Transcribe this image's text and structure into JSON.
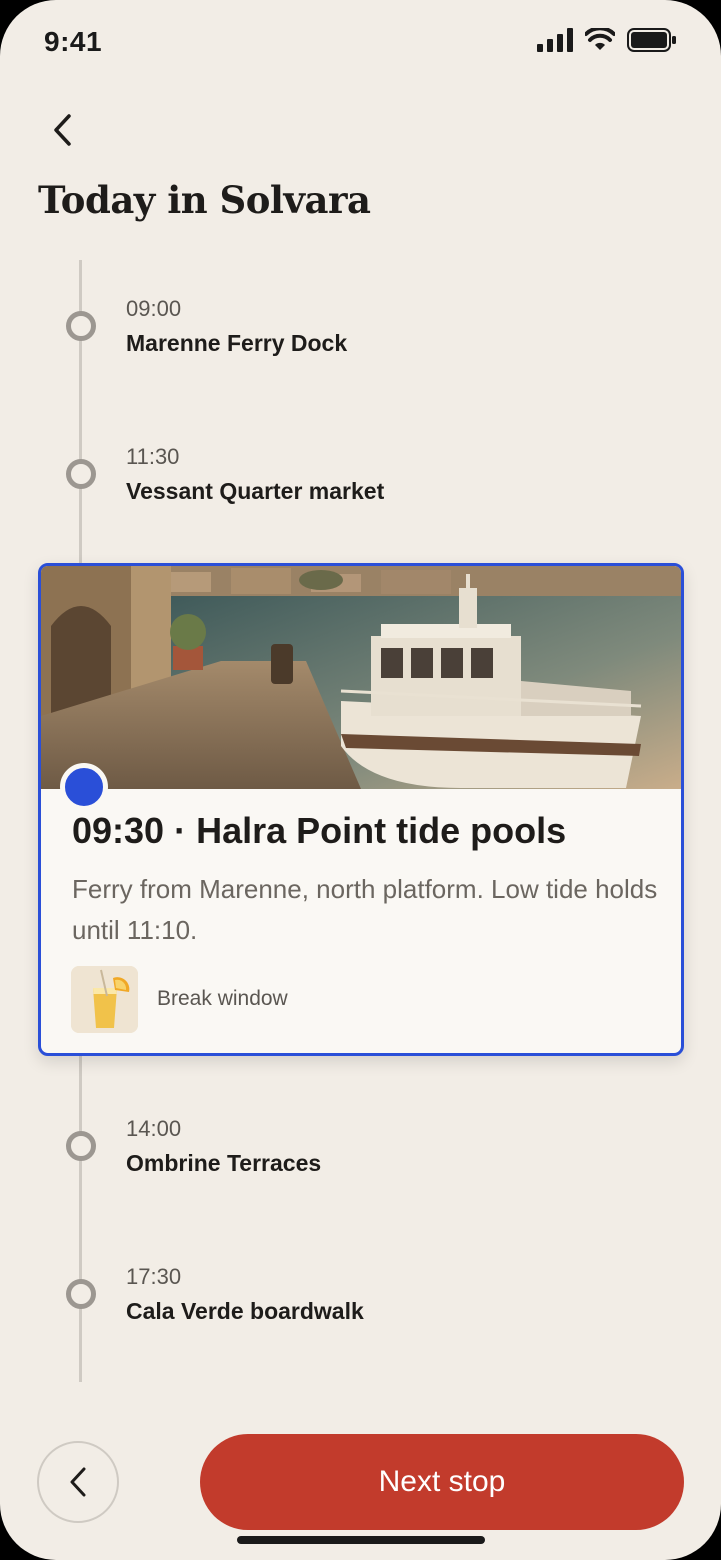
{
  "status_bar": {
    "time": "9:41",
    "icons": [
      "signal-icon",
      "wifi-icon",
      "battery-icon"
    ]
  },
  "header": {
    "back_icon": "chevron-left-icon",
    "title": "Today in Solvara"
  },
  "timeline": {
    "stops_before": [
      {
        "time": "09:00",
        "name": "Marenne Ferry Dock"
      },
      {
        "time": "11:30",
        "name": "Vessant Quarter market"
      }
    ],
    "featured": {
      "title": "09:30 · Halra Point tide pools",
      "description": "Ferry from Marenne, north platform. Low tide holds until 11:10.",
      "break_label": "Break window"
    },
    "stops_after": [
      {
        "time": "14:00",
        "name": "Ombrine Terraces"
      },
      {
        "time": "17:30",
        "name": "Cala Verde boardwalk"
      }
    ]
  },
  "footer": {
    "prev_icon": "chevron-left-icon",
    "next_label": "Next stop"
  },
  "colors": {
    "background": "#f2ede6",
    "accent_blue": "#2a4fd8",
    "primary_button": "#c23b2c",
    "text_primary": "#1e1c1a",
    "text_secondary": "#6b6660"
  }
}
